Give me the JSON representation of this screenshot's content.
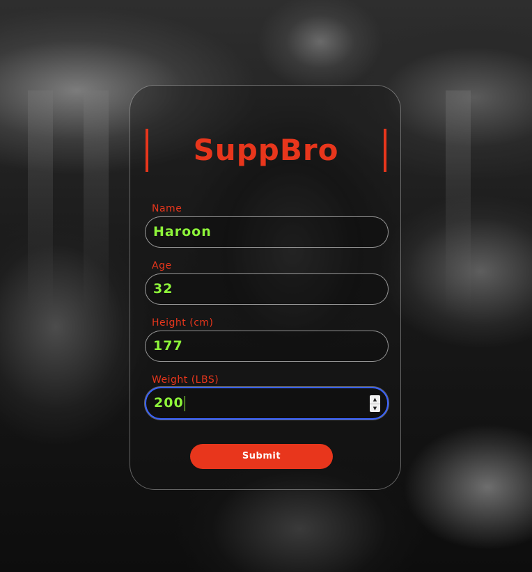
{
  "app": {
    "title": "SuppBro"
  },
  "form": {
    "fields": [
      {
        "label": "Name",
        "value": "Haroon"
      },
      {
        "label": "Age",
        "value": "32"
      },
      {
        "label": "Height (cm)",
        "value": "177"
      },
      {
        "label": "Weight (LBS)",
        "value": "200"
      }
    ],
    "submit_label": "Submit"
  },
  "colors": {
    "accent": "#e8361c",
    "value_text": "#8ef53a",
    "focus_ring": "#3a63ff"
  },
  "icons": {
    "spinner_up": "chevron-up-icon",
    "spinner_down": "chevron-down-icon"
  }
}
